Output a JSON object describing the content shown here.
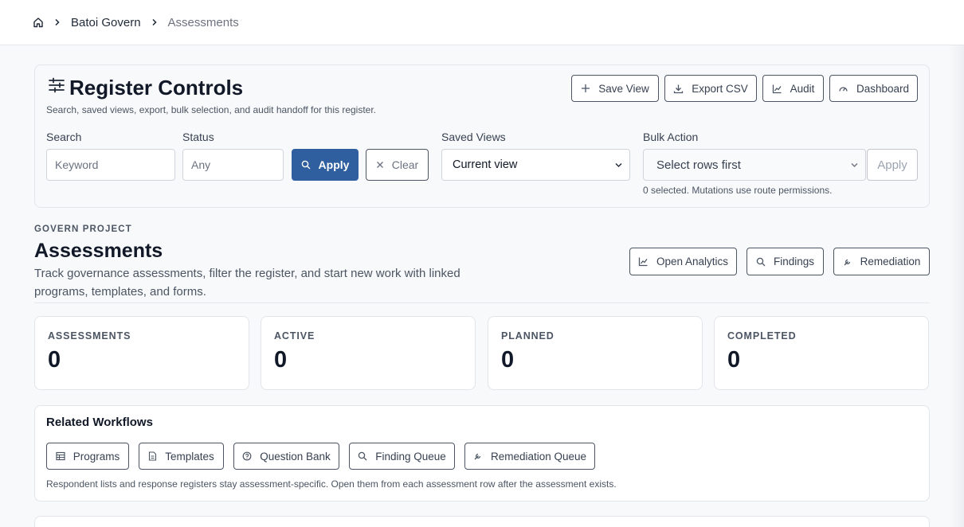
{
  "breadcrumb": {
    "project": "Batoi Govern",
    "current": "Assessments"
  },
  "register_controls": {
    "title": "Register Controls",
    "subtitle": "Search, saved views, export, bulk selection, and audit handoff for this register.",
    "actions": {
      "save_view": "Save View",
      "export_csv": "Export CSV",
      "audit": "Audit",
      "dashboard": "Dashboard"
    },
    "search": {
      "label": "Search",
      "placeholder": "Keyword"
    },
    "status": {
      "label": "Status",
      "placeholder": "Any"
    },
    "apply_label": "Apply",
    "clear_label": "Clear",
    "saved_views": {
      "label": "Saved Views",
      "value": "Current view"
    },
    "bulk_action": {
      "label": "Bulk Action",
      "value": "Select rows first",
      "apply_label": "Apply"
    },
    "selection_note": "0 selected. Mutations use route permissions."
  },
  "header": {
    "eyebrow": "GOVERN PROJECT",
    "title": "Assessments",
    "description_line1": "Track governance assessments, filter the register, and start new work with linked",
    "description_line2": "programs, templates, and forms.",
    "actions": {
      "open_analytics": "Open Analytics",
      "findings": "Findings",
      "remediation": "Remediation"
    }
  },
  "stats": [
    {
      "label": "ASSESSMENTS",
      "value": "0"
    },
    {
      "label": "ACTIVE",
      "value": "0"
    },
    {
      "label": "PLANNED",
      "value": "0"
    },
    {
      "label": "COMPLETED",
      "value": "0"
    }
  ],
  "related": {
    "title": "Related Workflows",
    "links": {
      "programs": "Programs",
      "templates": "Templates",
      "question_bank": "Question Bank",
      "finding_queue": "Finding Queue",
      "remediation_queue": "Remediation Queue"
    },
    "note": "Respondent lists and response registers stay assessment-specific. Open them from each assessment row after the assessment exists."
  },
  "colors": {
    "primary": "#2f5f9e",
    "border": "#4b5563",
    "text": "#1f2937"
  }
}
